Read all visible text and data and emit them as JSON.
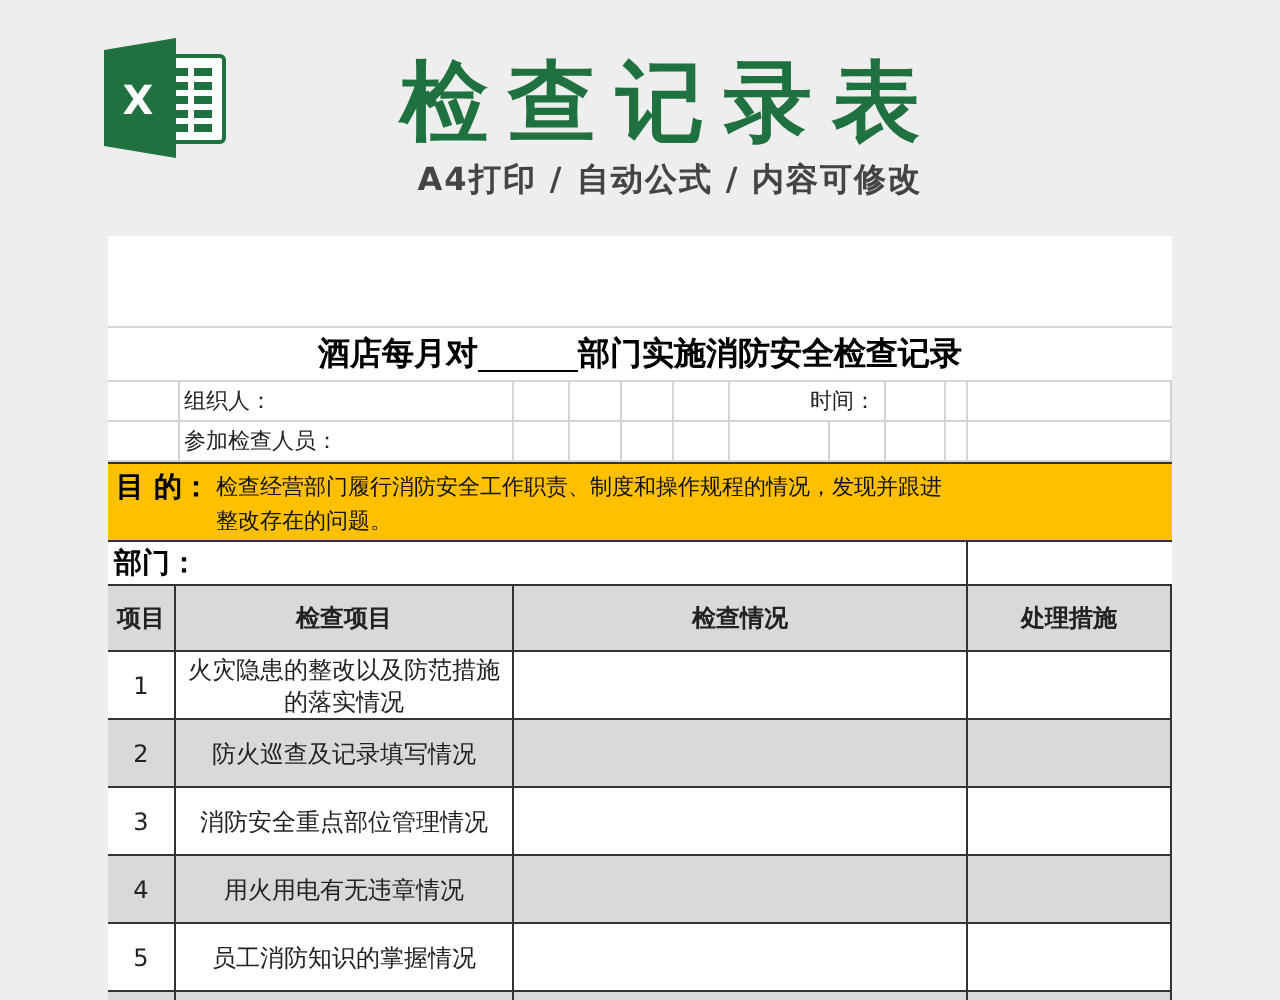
{
  "header": {
    "logo_letter": "X",
    "title": "检查记录表",
    "subtitle": "A4打印 / 自动公式 / 内容可修改"
  },
  "sheet": {
    "title_before": "酒店每月对",
    "title_after": "部门实施消防安全检查记录",
    "organizer_label": "组织人：",
    "time_label": "时间：",
    "participants_label": "参加检查人员：",
    "purpose_label": "目 的：",
    "purpose_text": "检查经营部门履行消防安全工作职责、制度和操作规程的情况，发现并跟进整改存在的问题。",
    "department_label": "部门：",
    "columns": [
      "项目",
      "检查项目",
      "检查情况",
      "处理措施"
    ],
    "rows": [
      {
        "no": "1",
        "item": "火灾隐患的整改以及防范措施的落实情况"
      },
      {
        "no": "2",
        "item": "防火巡查及记录填写情况"
      },
      {
        "no": "3",
        "item": "消防安全重点部位管理情况"
      },
      {
        "no": "4",
        "item": "用火用电有无违章情况"
      },
      {
        "no": "5",
        "item": "员工消防知识的掌握情况"
      }
    ]
  }
}
